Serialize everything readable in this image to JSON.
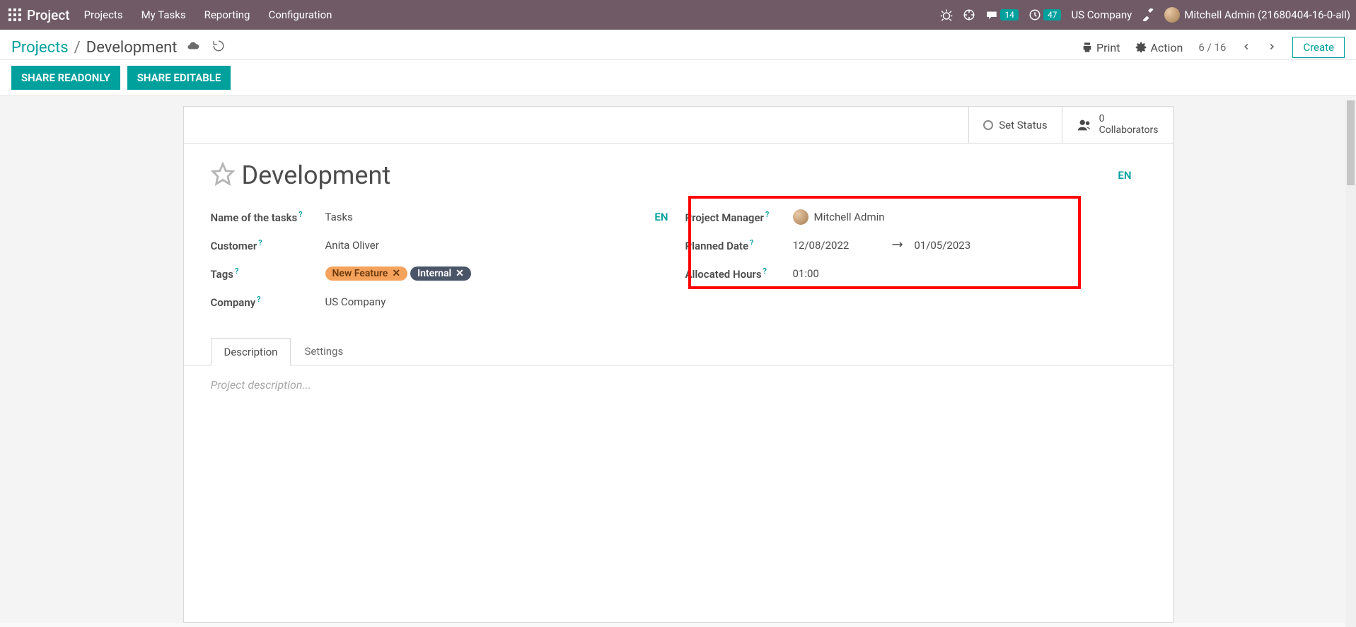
{
  "topnav": {
    "brand": "Project",
    "items": [
      "Projects",
      "My Tasks",
      "Reporting",
      "Configuration"
    ],
    "messages_badge": "14",
    "activities_badge": "47",
    "company": "US Company",
    "user": "Mitchell Admin (21680404-16-0-all)"
  },
  "breadcrumb": {
    "root": "Projects",
    "current": "Development"
  },
  "controls": {
    "print": "Print",
    "action": "Action",
    "pager": "6 / 16",
    "create": "Create"
  },
  "share": {
    "readonly": "SHARE READONLY",
    "editable": "SHARE EDITABLE"
  },
  "statusbar": {
    "set_status": "Set Status",
    "collab_count": "0",
    "collab_label": "Collaborators"
  },
  "title": {
    "text": "Development",
    "lang": "EN"
  },
  "fields_left": {
    "name_tasks_lbl": "Name of the tasks",
    "name_tasks_val": "Tasks",
    "name_tasks_lang": "EN",
    "customer_lbl": "Customer",
    "customer_val": "Anita Oliver",
    "tags_lbl": "Tags",
    "company_lbl": "Company",
    "company_val": "US Company"
  },
  "tags": [
    {
      "label": "New Feature",
      "cls": "orange"
    },
    {
      "label": "Internal",
      "cls": "slate"
    }
  ],
  "fields_right": {
    "pm_lbl": "Project Manager",
    "pm_val": "Mitchell Admin",
    "date_lbl": "Planned Date",
    "date_start": "12/08/2022",
    "date_end": "01/05/2023",
    "hours_lbl": "Allocated Hours",
    "hours_val": "01:00"
  },
  "tabs": {
    "description": "Description",
    "settings": "Settings"
  },
  "description_placeholder": "Project description..."
}
